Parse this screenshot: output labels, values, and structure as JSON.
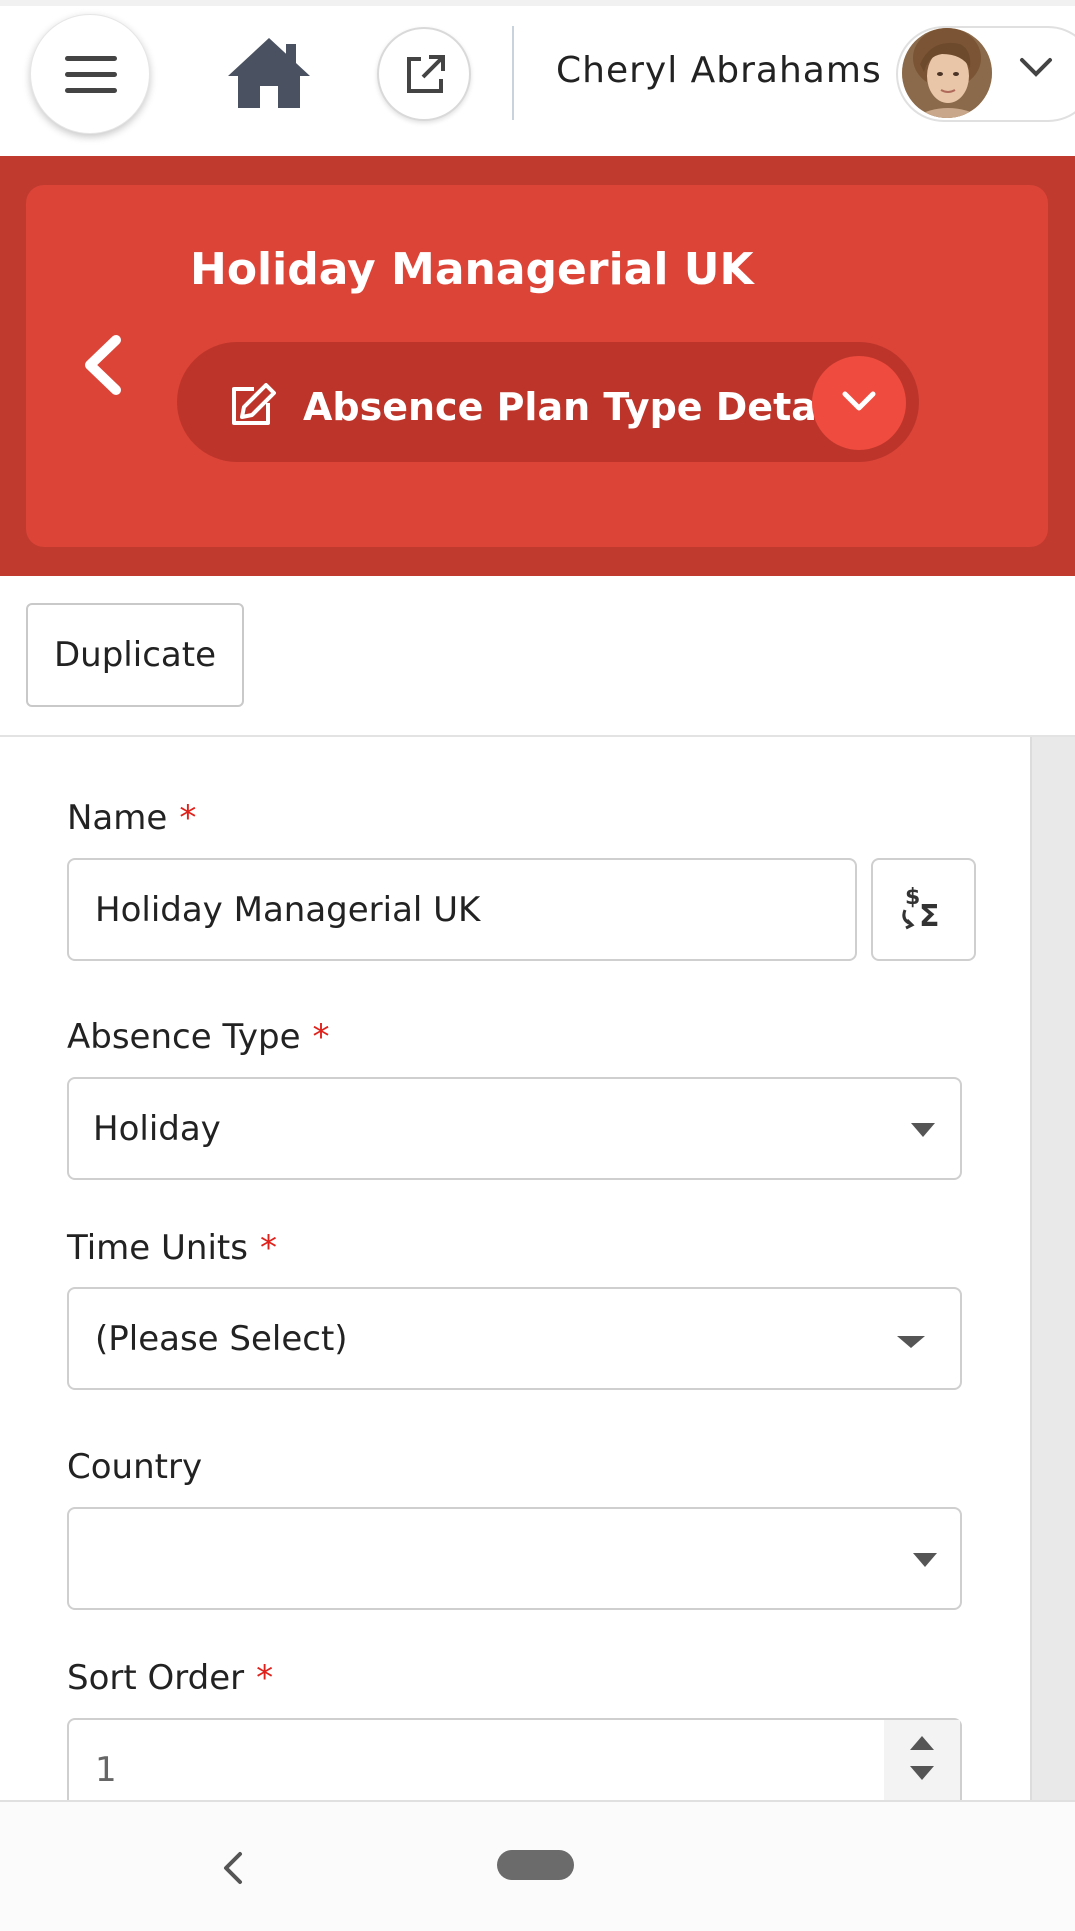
{
  "header": {
    "user_name": "Cheryl Abrahams",
    "menu_icon": "hamburger-menu-icon",
    "home_icon": "home-icon",
    "open_external_icon": "open-external-icon",
    "user_menu_icon": "chevron-down-icon"
  },
  "record": {
    "title": "Holiday Managerial UK",
    "view_label": "Absence Plan Type Details",
    "back_icon": "chevron-left-icon",
    "view_icon": "edit-icon",
    "view_dropdown_icon": "chevron-down-icon"
  },
  "toolbar": {
    "duplicate_label": "Duplicate"
  },
  "form": {
    "name": {
      "label": "Name",
      "required": "*",
      "value": "Holiday Managerial UK",
      "formula_icon": "currency-sum-icon"
    },
    "absence_type": {
      "label": "Absence Type",
      "required": "*",
      "value": "Holiday"
    },
    "time_units": {
      "label": "Time Units",
      "required": "*",
      "value": "(Please Select)"
    },
    "country": {
      "label": "Country",
      "value": ""
    },
    "sort_order": {
      "label": "Sort Order",
      "required": "*",
      "value": "1"
    }
  },
  "system_nav": {
    "back_icon": "nav-back-icon",
    "home_icon": "nav-home-pill-icon"
  },
  "colors": {
    "brand_red": "#dc4438",
    "brand_red_dark": "#c13a2e",
    "accent_red": "#ef4b3f",
    "required_star": "#e0211b"
  }
}
